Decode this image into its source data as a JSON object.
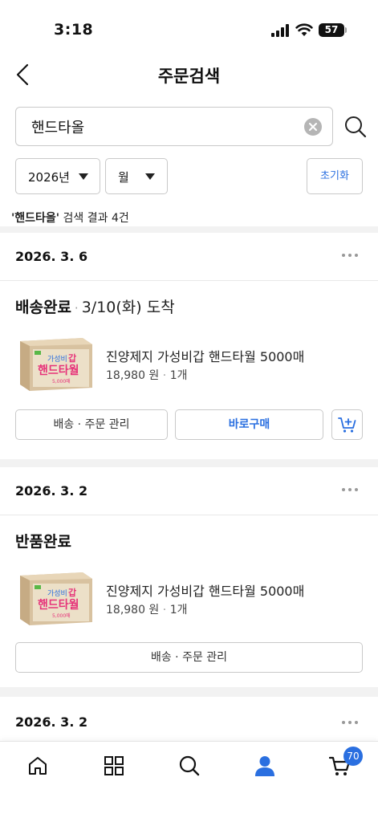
{
  "status_bar": {
    "time": "3:18",
    "battery": "57"
  },
  "header": {
    "title": "주문검색"
  },
  "search": {
    "value": "핸드타올"
  },
  "filters": {
    "year": "2026년",
    "month": "월",
    "reset_label": "초기화"
  },
  "result_summary": {
    "query": "'핸드타올'",
    "text": " 검색 결과 4건"
  },
  "orders": [
    {
      "date": "2026. 3. 6",
      "status": "배송완료",
      "status_extra": "3/10(화) 도착",
      "product": {
        "name": "진양제지 가성비갑 핸드타월 5000매",
        "price": "18,980 원",
        "qty": "1개"
      },
      "buttons": {
        "manage": "배송 · 주문 관리",
        "buy_now": "바로구매"
      }
    },
    {
      "date": "2026. 3. 2",
      "status": "반품완료",
      "product": {
        "name": "진양제지 가성비갑 핸드타월 5000매",
        "price": "18,980 원",
        "qty": "1개"
      },
      "buttons": {
        "manage": "배송 · 주문 관리"
      }
    },
    {
      "date": "2026. 3. 2"
    }
  ],
  "product_box_art": {
    "line1": "가성비",
    "line1b": "갑",
    "line2": "핸드타월",
    "count": "5,000매"
  },
  "tabbar": {
    "cart_count": "70",
    "icons": [
      "home-icon",
      "category-grid-icon",
      "search-icon",
      "my-page-icon",
      "cart-icon"
    ]
  },
  "colors": {
    "accent": "#2a6fe0",
    "brand_green": "#59b847",
    "brand_pink": "#e6337a"
  }
}
